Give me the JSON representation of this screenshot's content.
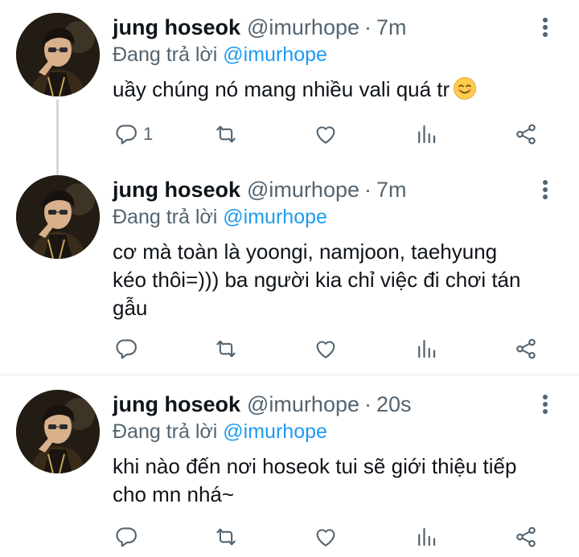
{
  "tweets": [
    {
      "name": "jung hoseok",
      "handle": "@imurhope",
      "separator": "·",
      "time": "7m",
      "replying_prefix": "Đang trả lời",
      "replying_to": "@imurhope",
      "text": "uầy chúng nó mang nhiều vali quá tr",
      "emoji": "smiling-face-emoji",
      "reply_count": "1"
    },
    {
      "name": "jung hoseok",
      "handle": "@imurhope",
      "separator": "·",
      "time": "7m",
      "replying_prefix": "Đang trả lời",
      "replying_to": "@imurhope",
      "text_lines": [
        "cơ mà toàn là yoongi, namjoon, taehyung",
        "kéo thôi=))) ba người kia chỉ việc đi chơi tán",
        "gẫu"
      ],
      "reply_count": ""
    },
    {
      "name": "jung hoseok",
      "handle": "@imurhope",
      "separator": "·",
      "time": "20s",
      "replying_prefix": "Đang trả lời",
      "replying_to": "@imurhope",
      "text_lines": [
        "khi nào đến nơi hoseok tui sẽ giới thiệu tiếp",
        "cho mn nhá~"
      ],
      "reply_count": ""
    }
  ],
  "icons": {
    "reply": "reply-icon",
    "retweet": "retweet-icon",
    "like": "heart-icon",
    "views": "analytics-icon",
    "share": "share-icon",
    "more": "more-vertical-icon"
  },
  "colors": {
    "text": "#0f1419",
    "secondary": "#536471",
    "link": "#1d9bf0",
    "thread_line": "#cfd9de",
    "divider": "#e3e8eb"
  }
}
